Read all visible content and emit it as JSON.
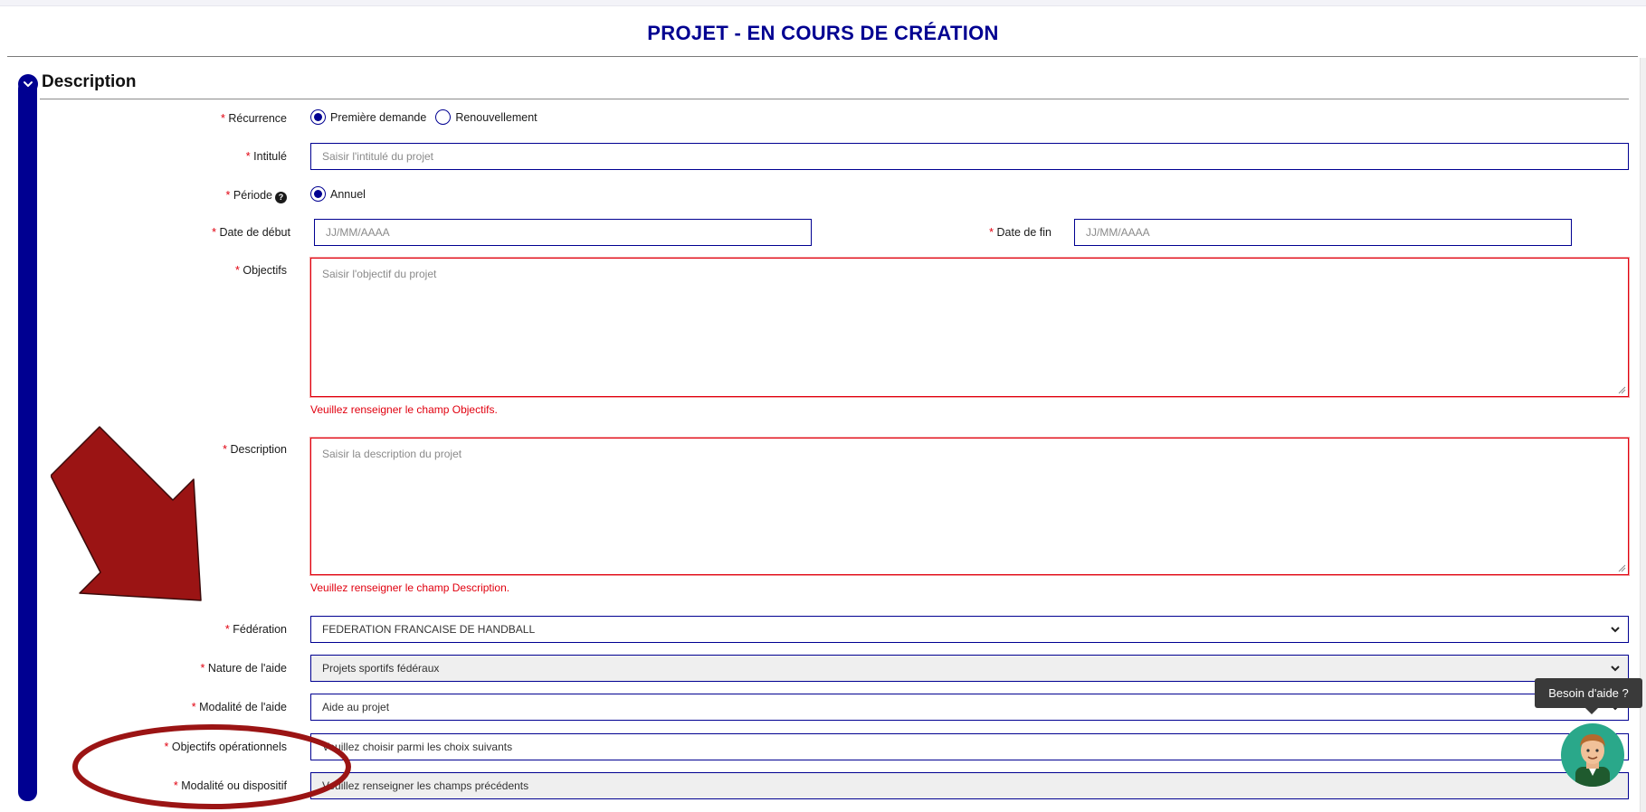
{
  "header": {
    "title": "PROJET - EN COURS DE CRÉATION"
  },
  "section": {
    "title": "Description"
  },
  "required_mark": "*",
  "form": {
    "recurrence": {
      "label": "Récurrence",
      "options": [
        "Première demande",
        "Renouvellement"
      ],
      "selected": "Première demande"
    },
    "intitule": {
      "label": "Intitulé",
      "placeholder": "Saisir l'intitulé du projet"
    },
    "periode": {
      "label": "Période",
      "options": [
        "Annuel"
      ],
      "selected": "Annuel"
    },
    "date_debut": {
      "label": "Date de début",
      "placeholder": "JJ/MM/AAAA"
    },
    "date_fin": {
      "label": "Date de fin",
      "placeholder": "JJ/MM/AAAA"
    },
    "objectifs": {
      "label": "Objectifs",
      "placeholder": "Saisir l'objectif du projet",
      "error": "Veuillez renseigner le champ Objectifs."
    },
    "description": {
      "label": "Description",
      "placeholder": "Saisir la description du projet",
      "error": "Veuillez renseigner le champ Description."
    },
    "federation": {
      "label": "Fédération",
      "value": "FEDERATION FRANCAISE DE HANDBALL"
    },
    "nature_aide": {
      "label": "Nature de l'aide",
      "value": "Projets sportifs fédéraux"
    },
    "modalite_aide": {
      "label": "Modalité de l'aide",
      "value": "Aide au projet"
    },
    "objectifs_operationnels": {
      "label": "Objectifs opérationnels",
      "value": "Veuillez choisir parmi les choix suivants"
    },
    "modalite_dispositif": {
      "label": "Modalité ou dispositif",
      "value": "Veuillez renseigner les champs précédents"
    }
  },
  "help_widget": {
    "tooltip": "Besoin d'aide ?"
  },
  "icons": {
    "section_toggle": "chevron-down-icon",
    "period_help": "question-circle-icon",
    "select_arrow": "chevron-down-icon",
    "annotation_arrow": "red-arrow-annotation",
    "annotation_circle": "red-ellipse-annotation"
  },
  "colors": {
    "primary": "#000091",
    "required": "#e1000f",
    "error": "#e1000f",
    "annotation": "#9b1414",
    "help_avatar_bg": "#2aa88a"
  }
}
